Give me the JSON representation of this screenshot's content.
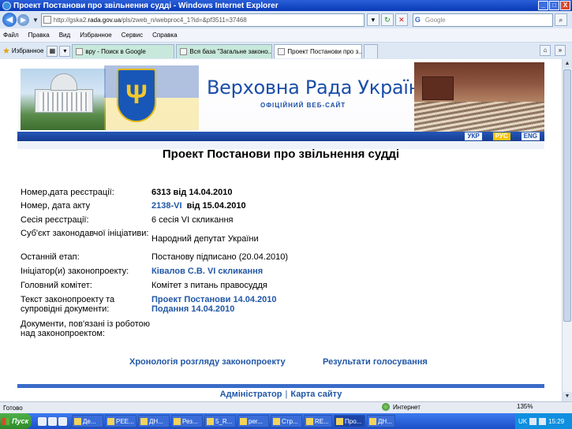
{
  "window": {
    "title": "Проект Постанови про звільнення судді - Windows Internet Explorer",
    "controls": [
      "_",
      "□",
      "X"
    ]
  },
  "addressbar": {
    "url_prefix": "http://gska2.",
    "url_domain": "rada.gov.ua",
    "url_rest": "/pls/zweb_n/webproc4_1?id=&pf3511=37468",
    "search_placeholder": "Google"
  },
  "menu": [
    "Файл",
    "Правка",
    "Вид",
    "Избранное",
    "Сервис",
    "Справка"
  ],
  "favorites_label": "Избранное",
  "tabs": [
    {
      "label": "вру - Поиск в Google",
      "active": false
    },
    {
      "label": "Вся база \"Загальне законо...",
      "active": false
    },
    {
      "label": "Проект Постанови про з...",
      "active": true
    }
  ],
  "banner": {
    "title": "Верховна Рада України",
    "subtitle": "ОФІЦІЙНИЙ ВЕБ-САЙТ",
    "trident": "Ψ",
    "langs": [
      "УКР",
      "РУС",
      "ENG"
    ]
  },
  "page_title": "Проект Постанови про звільнення судді",
  "info": {
    "reg_label": "Номер,дата реєстрації:",
    "reg_value": "6313 від 14.04.2010",
    "act_label": "Номер, дата акту",
    "act_link": "2138-VI",
    "act_date": "від 15.04.2010",
    "session_label": "Сесія реєстрації:",
    "session_value": "6 сесія VI скликання",
    "subject_label": "Суб'єкт законодавчої ініціативи:",
    "subject_value": "Народний депутат України",
    "stage_label": "Останній етап:",
    "stage_value": "Постанову підписано (20.04.2010)",
    "initiator_label": "Ініціатор(и) законопроекту:",
    "initiator_value": "Ківалов С.В. VI скликання",
    "committee_label": "Головний комітет:",
    "committee_value": "Комітет з питань правосуддя",
    "text_label": "Текст законопроекту та супровідні документи:",
    "text_link1": "Проект Постанови 14.04.2010",
    "text_link2": "Подання 14.04.2010",
    "docs_label": "Документи, пов'язані із роботою над законопроектом:"
  },
  "bottom_links": {
    "chronology": "Хронологія розгляду законопроекту",
    "voting": "Результати голосування"
  },
  "footer": {
    "admin": "Адміністратор",
    "sep": "|",
    "sitemap": "Карта сайту"
  },
  "status": {
    "text": "Готово",
    "zone": "Интернет",
    "zoom": "135%"
  },
  "taskbar": {
    "start": "Пуск",
    "items": [
      "Де...",
      "РЕЕ...",
      "ДН...",
      "Рез...",
      "5_R...",
      "per...",
      "Стр...",
      "RE...",
      "Про...",
      "ДН..."
    ],
    "time": "15:29",
    "lang": "UK"
  }
}
